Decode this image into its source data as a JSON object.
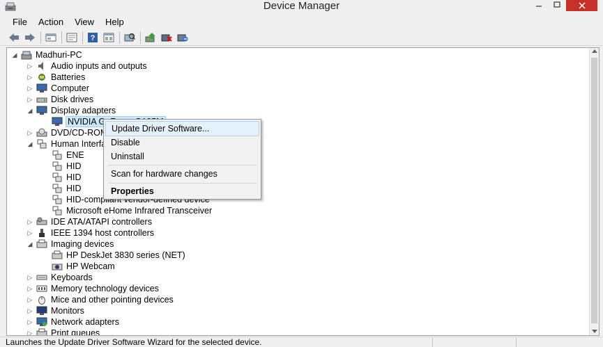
{
  "window": {
    "title": "Device Manager"
  },
  "menu": [
    "File",
    "Action",
    "View",
    "Help"
  ],
  "toolbar": [
    "back-icon",
    "forward-icon",
    "show-hide-icon",
    "properties-icon",
    "help-icon",
    "view-icon",
    "scan-icon",
    "update-driver-icon",
    "disable-icon",
    "uninstall-icon"
  ],
  "tree": {
    "root": "Madhuri-PC",
    "items": [
      {
        "label": "Audio inputs and outputs"
      },
      {
        "label": "Batteries"
      },
      {
        "label": "Computer"
      },
      {
        "label": "Disk drives"
      },
      {
        "label": "Display adapters"
      },
      {
        "label": "NVIDIA GeForce G105M"
      },
      {
        "label": "DVD/CD-ROM drives"
      },
      {
        "label": "Human Interface Devices"
      },
      {
        "label": "ENE"
      },
      {
        "label": "HID"
      },
      {
        "label": "HID"
      },
      {
        "label": "HID"
      },
      {
        "label": "HID-compliant vendor-defined device"
      },
      {
        "label": "Microsoft eHome Infrared Transceiver"
      },
      {
        "label": "IDE ATA/ATAPI controllers"
      },
      {
        "label": "IEEE 1394 host controllers"
      },
      {
        "label": "Imaging devices"
      },
      {
        "label": "HP DeskJet 3830 series (NET)"
      },
      {
        "label": "HP Webcam"
      },
      {
        "label": "Keyboards"
      },
      {
        "label": "Memory technology devices"
      },
      {
        "label": "Mice and other pointing devices"
      },
      {
        "label": "Monitors"
      },
      {
        "label": "Network adapters"
      },
      {
        "label": "Print queues"
      }
    ]
  },
  "context_menu": {
    "update": "Update Driver Software...",
    "disable": "Disable",
    "uninstall": "Uninstall",
    "scan": "Scan for hardware changes",
    "properties": "Properties"
  },
  "status": {
    "text": "Launches the Update Driver Software Wizard for the selected device."
  },
  "colors": {
    "close_button": "#c7312a",
    "selection": "#cce8ff",
    "menu_highlight": "#e5f1fb"
  }
}
